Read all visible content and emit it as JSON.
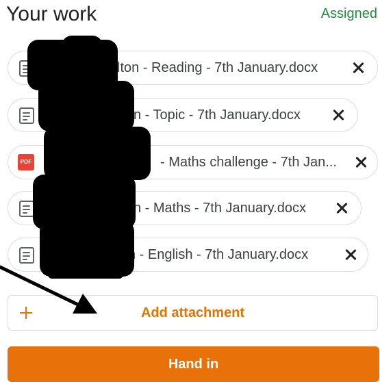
{
  "header": {
    "title": "Your work",
    "status": "Assigned"
  },
  "attachments": [
    {
      "name": "lton - Reading - 7th January.docx",
      "type": "doc-icon"
    },
    {
      "name": "n - Topic - 7th January.docx",
      "type": "doc-icon"
    },
    {
      "name": "- Maths challenge - 7th Jan...",
      "type": "pdf-icon",
      "badge": "PDF"
    },
    {
      "name": "n - Maths - 7th January.docx",
      "type": "doc-icon"
    },
    {
      "name": "n - English - 7th January.docx",
      "type": "doc-icon"
    }
  ],
  "actions": {
    "add_attachment": "Add attachment",
    "hand_in": "Hand in"
  },
  "colors": {
    "accent": "#e8710a",
    "accent_text": "#e37400",
    "status": "#1e8e3e",
    "pdf": "#ea4335"
  }
}
